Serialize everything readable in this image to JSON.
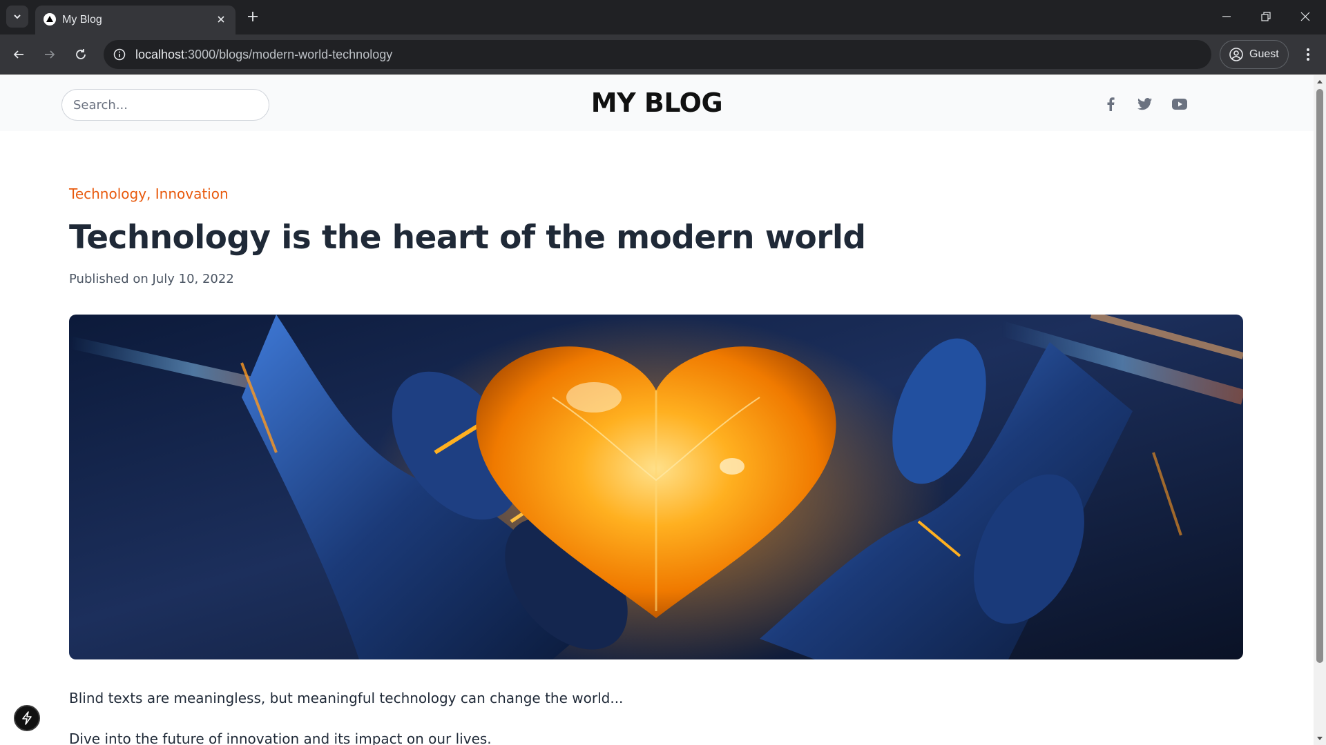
{
  "browser": {
    "tab_title": "My Blog",
    "url_host": "localhost",
    "url_path": ":3000/blogs/modern-world-technology",
    "profile_label": "Guest",
    "icons": {
      "tab_menu": "chevron-down-icon",
      "favicon": "triangle-logo-icon",
      "tab_close": "close-icon",
      "new_tab": "plus-icon",
      "minimize": "minimize-icon",
      "restore": "restore-icon",
      "close_window": "close-icon",
      "back": "arrow-left-icon",
      "forward": "arrow-right-icon",
      "reload": "reload-icon",
      "site_info": "info-icon",
      "profile": "account-circle-icon",
      "menu": "more-vertical-icon"
    }
  },
  "header": {
    "search_placeholder": "Search...",
    "brand": "MY BLOG",
    "social_icons": [
      "facebook-icon",
      "twitter-icon",
      "youtube-icon"
    ]
  },
  "article": {
    "categories": "Technology, Innovation",
    "title": "Technology is the heart of the modern world",
    "published": "Published on July 10, 2022",
    "hero_image_alt": "glowing orange heart held by robotic hands",
    "paragraphs": [
      "Blind texts are meaningless, but meaningful technology can change the world...",
      "Dive into the future of innovation and its impact on our lives."
    ]
  },
  "colors": {
    "accent": "#e8590c",
    "title": "#1f2937",
    "chrome_dark": "#202124",
    "chrome_toolbar": "#35363a"
  },
  "dev_badge_icon": "lightning-bolt-icon"
}
